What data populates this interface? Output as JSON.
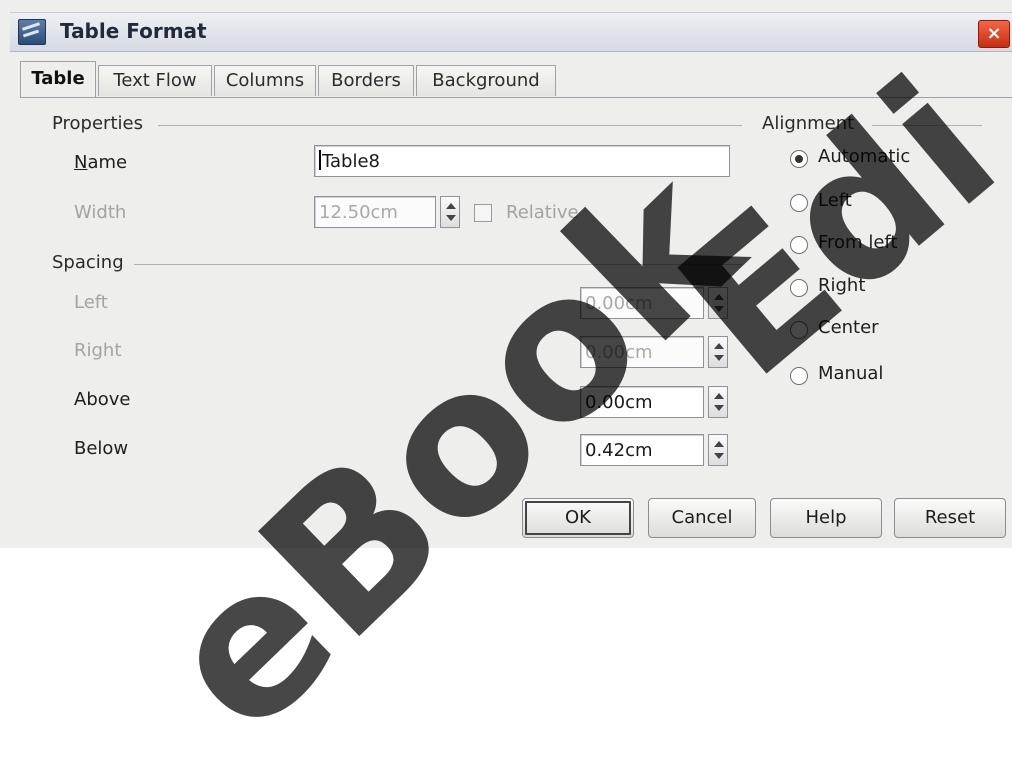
{
  "window": {
    "title": "Table Format",
    "close_label": "×"
  },
  "tabs": [
    {
      "label": "Table",
      "active": true
    },
    {
      "label": "Text Flow",
      "active": false
    },
    {
      "label": "Columns",
      "active": false
    },
    {
      "label": "Borders",
      "active": false
    },
    {
      "label": "Background",
      "active": false
    }
  ],
  "properties": {
    "section_label": "Properties",
    "name_label": "Name",
    "name_value": "Table8",
    "width_label": "Width",
    "width_value": "12.50cm",
    "relative_label": "Relative"
  },
  "spacing": {
    "section_label": "Spacing",
    "left_label": "Left",
    "left_value": "0.00cm",
    "right_label": "Right",
    "right_value": "0.00cm",
    "above_label": "Above",
    "above_value": "0.00cm",
    "below_label": "Below",
    "below_value": "0.42cm"
  },
  "alignment": {
    "section_label": "Alignment",
    "options": [
      {
        "label": "Automatic",
        "checked": true
      },
      {
        "label": "Left",
        "checked": false
      },
      {
        "label": "From left",
        "checked": false
      },
      {
        "label": "Right",
        "checked": false
      },
      {
        "label": "Center",
        "checked": false
      },
      {
        "label": "Manual",
        "checked": false
      }
    ]
  },
  "buttons": {
    "ok": "OK",
    "cancel": "Cancel",
    "help": "Help",
    "reset": "Reset"
  },
  "watermark": {
    "line1": "eBook",
    "line2": "Edi"
  }
}
